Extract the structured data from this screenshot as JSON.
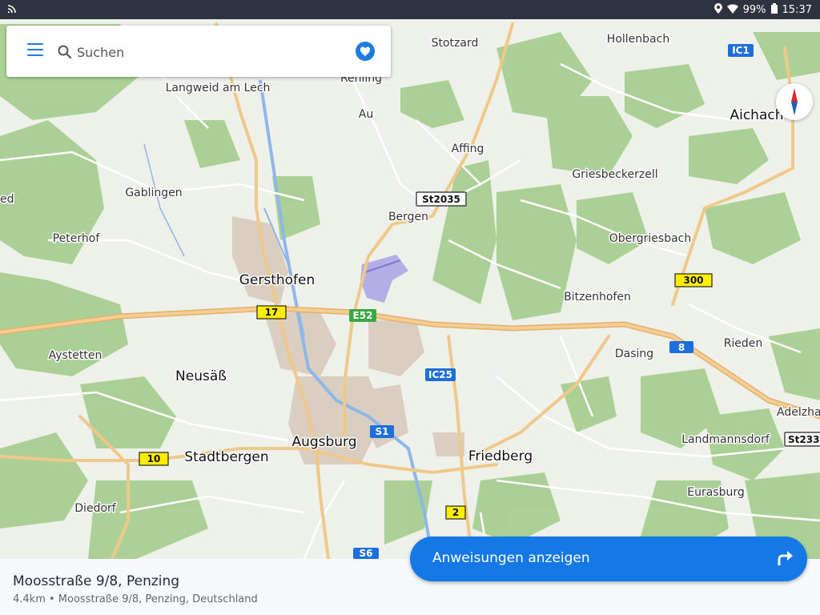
{
  "status_bar": {
    "battery": "99%",
    "time": "15:37"
  },
  "search": {
    "placeholder": "Suchen"
  },
  "places": [
    {
      "name": "Stotzard"
    },
    {
      "name": "Hollenbach"
    },
    {
      "name": "Rehling"
    },
    {
      "name": "Langweid am Lech"
    },
    {
      "name": "Au"
    },
    {
      "name": "Aichach"
    },
    {
      "name": "Affing"
    },
    {
      "name": "Griesbeckerzell"
    },
    {
      "name": "Gablingen"
    },
    {
      "name": "ed"
    },
    {
      "name": "Bergen"
    },
    {
      "name": "Peterhof"
    },
    {
      "name": "Obergriesbach"
    },
    {
      "name": "Gersthofen"
    },
    {
      "name": "Bitzenhofen"
    },
    {
      "name": "Aystetten"
    },
    {
      "name": "Dasing"
    },
    {
      "name": "Rieden"
    },
    {
      "name": "Neusäß"
    },
    {
      "name": "Adelzha"
    },
    {
      "name": "Augsburg"
    },
    {
      "name": "Stadtbergen"
    },
    {
      "name": "Friedberg"
    },
    {
      "name": "Landmannsdorf"
    },
    {
      "name": "Eurasburg"
    },
    {
      "name": "Diedorf"
    }
  ],
  "road_shields": [
    {
      "label": "IC1",
      "kind": "blue"
    },
    {
      "label": "St2035",
      "kind": "white"
    },
    {
      "label": "300",
      "kind": "yellow"
    },
    {
      "label": "17",
      "kind": "yellow"
    },
    {
      "label": "E52",
      "kind": "green"
    },
    {
      "label": "8",
      "kind": "blue"
    },
    {
      "label": "IC25",
      "kind": "blue"
    },
    {
      "label": "S1",
      "kind": "blue"
    },
    {
      "label": "10",
      "kind": "yellow"
    },
    {
      "label": "St233",
      "kind": "white"
    },
    {
      "label": "2",
      "kind": "yellow"
    },
    {
      "label": "S6",
      "kind": "blue"
    }
  ],
  "bottom_panel": {
    "title": "Moosstraße 9/8, Penzing",
    "subtitle": "4.4km • Moosstraße 9/8, Penzing, Deutschland"
  },
  "directions_button": {
    "label": "Anweisungen anzeigen"
  },
  "colors": {
    "accent": "#1479e6",
    "land": "#eef0ea",
    "forest": "#9fc98a",
    "urban": "#d8cdbf",
    "water": "#8fb6e8",
    "major_road": "#f1c98b"
  },
  "icons": [
    "menu-icon",
    "search-icon",
    "heart-icon",
    "compass-icon",
    "turn-right-icon",
    "location-pin-icon",
    "wifi-icon",
    "battery-icon",
    "notification-icon"
  ]
}
